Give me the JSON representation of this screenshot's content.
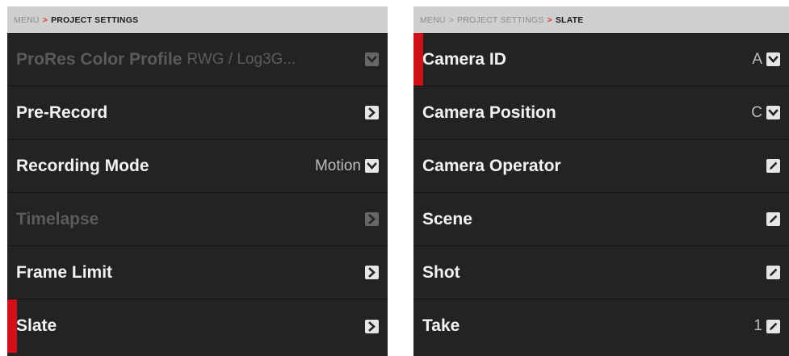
{
  "left": {
    "breadcrumb": {
      "root": "MENU",
      "separator": ">",
      "current": "PROJECT SETTINGS"
    },
    "rows": [
      {
        "label": "ProRes Color Profile",
        "value": "RWG / Log3G...",
        "control": "chevron-down-icon",
        "disabled": true
      },
      {
        "label": "Pre-Record",
        "value": "",
        "control": "chevron-right-icon",
        "disabled": false
      },
      {
        "label": "Recording Mode",
        "value": "Motion",
        "control": "chevron-down-icon",
        "disabled": false
      },
      {
        "label": "Timelapse",
        "value": "",
        "control": "chevron-right-icon",
        "disabled": true
      },
      {
        "label": "Frame Limit",
        "value": "",
        "control": "chevron-right-icon",
        "disabled": false
      },
      {
        "label": "Slate",
        "value": "",
        "control": "chevron-right-icon",
        "disabled": false,
        "selected": true
      }
    ]
  },
  "right": {
    "breadcrumb": {
      "root": "MENU",
      "separator": ">",
      "middle": "PROJECT SETTINGS",
      "current": "SLATE"
    },
    "rows": [
      {
        "label": "Camera ID",
        "value": "A",
        "control": "chevron-down-icon",
        "selected": true
      },
      {
        "label": "Camera Position",
        "value": "C",
        "control": "chevron-down-icon"
      },
      {
        "label": "Camera Operator",
        "value": "",
        "control": "pencil-icon"
      },
      {
        "label": "Scene",
        "value": "",
        "control": "pencil-icon"
      },
      {
        "label": "Shot",
        "value": "",
        "control": "pencil-icon"
      },
      {
        "label": "Take",
        "value": "1",
        "control": "pencil-icon"
      }
    ]
  },
  "colors": {
    "panel_bg": "#232323",
    "breadcrumb_bg": "#cfcfcf",
    "accent_red": "#d0111a",
    "text": "#f2f2f2",
    "disabled_text": "#5b5b5b"
  }
}
